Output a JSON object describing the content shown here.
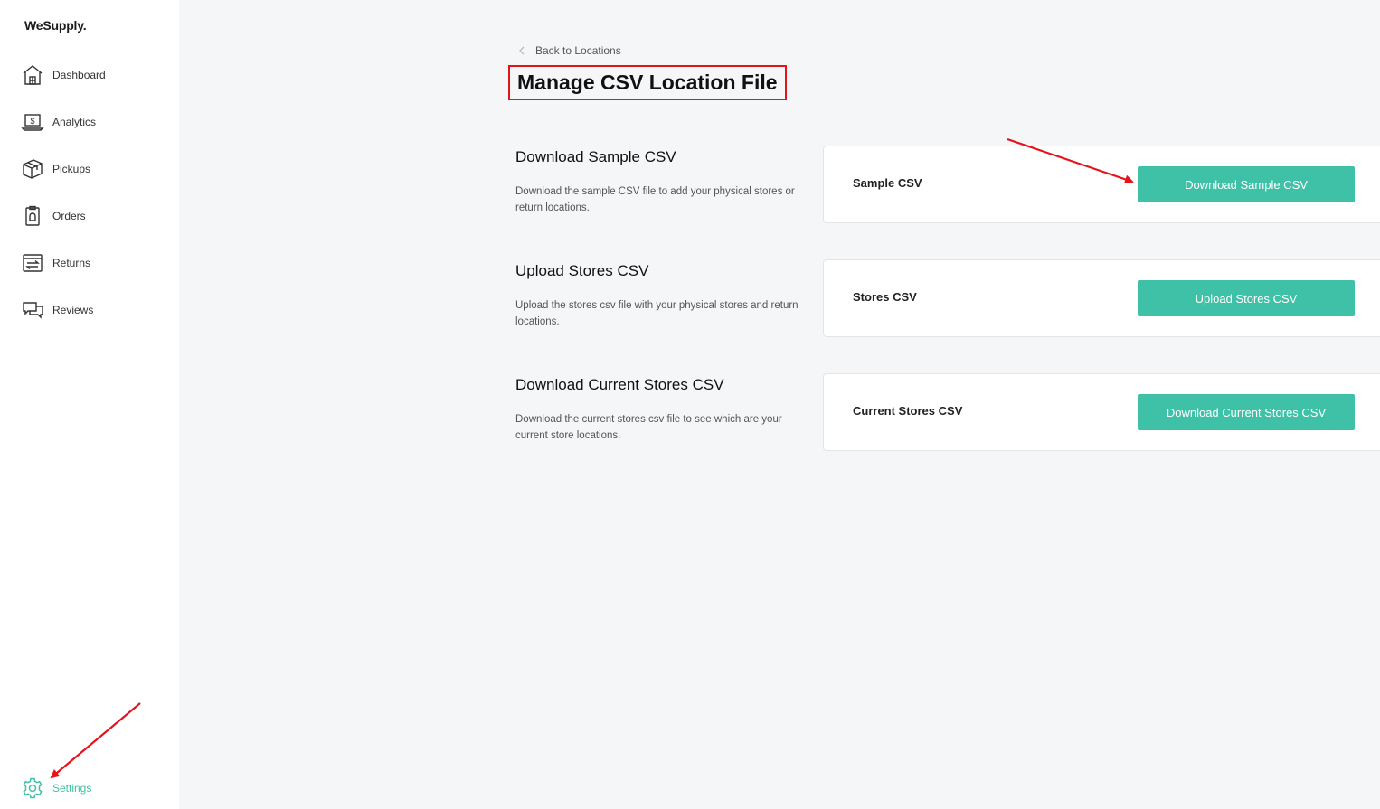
{
  "app": {
    "logo": "WeSupply."
  },
  "sidebar": {
    "items": [
      {
        "label": "Dashboard",
        "icon": "home-icon"
      },
      {
        "label": "Analytics",
        "icon": "laptop-dollar-icon"
      },
      {
        "label": "Pickups",
        "icon": "box-icon"
      },
      {
        "label": "Orders",
        "icon": "clipboard-icon"
      },
      {
        "label": "Returns",
        "icon": "returns-icon"
      },
      {
        "label": "Reviews",
        "icon": "chat-icon"
      }
    ],
    "settings": {
      "label": "Settings",
      "icon": "gear-icon"
    }
  },
  "header": {
    "back_label": "Back to Locations",
    "title": "Manage CSV Location File"
  },
  "sections": [
    {
      "title": "Download Sample CSV",
      "description": "Download the sample CSV file to add your physical stores or return locations.",
      "card_label": "Sample CSV",
      "button_label": "Download Sample CSV"
    },
    {
      "title": "Upload Stores CSV",
      "description": "Upload the stores csv file with your physical stores and return locations.",
      "card_label": "Stores CSV",
      "button_label": "Upload Stores CSV"
    },
    {
      "title": "Download Current Stores CSV",
      "description": "Download the current stores csv file to see which are your current store locations.",
      "card_label": "Current Stores CSV",
      "button_label": "Download Current Stores CSV"
    }
  ],
  "colors": {
    "accent": "#3ec1a6",
    "annotation": "#e5141b"
  }
}
